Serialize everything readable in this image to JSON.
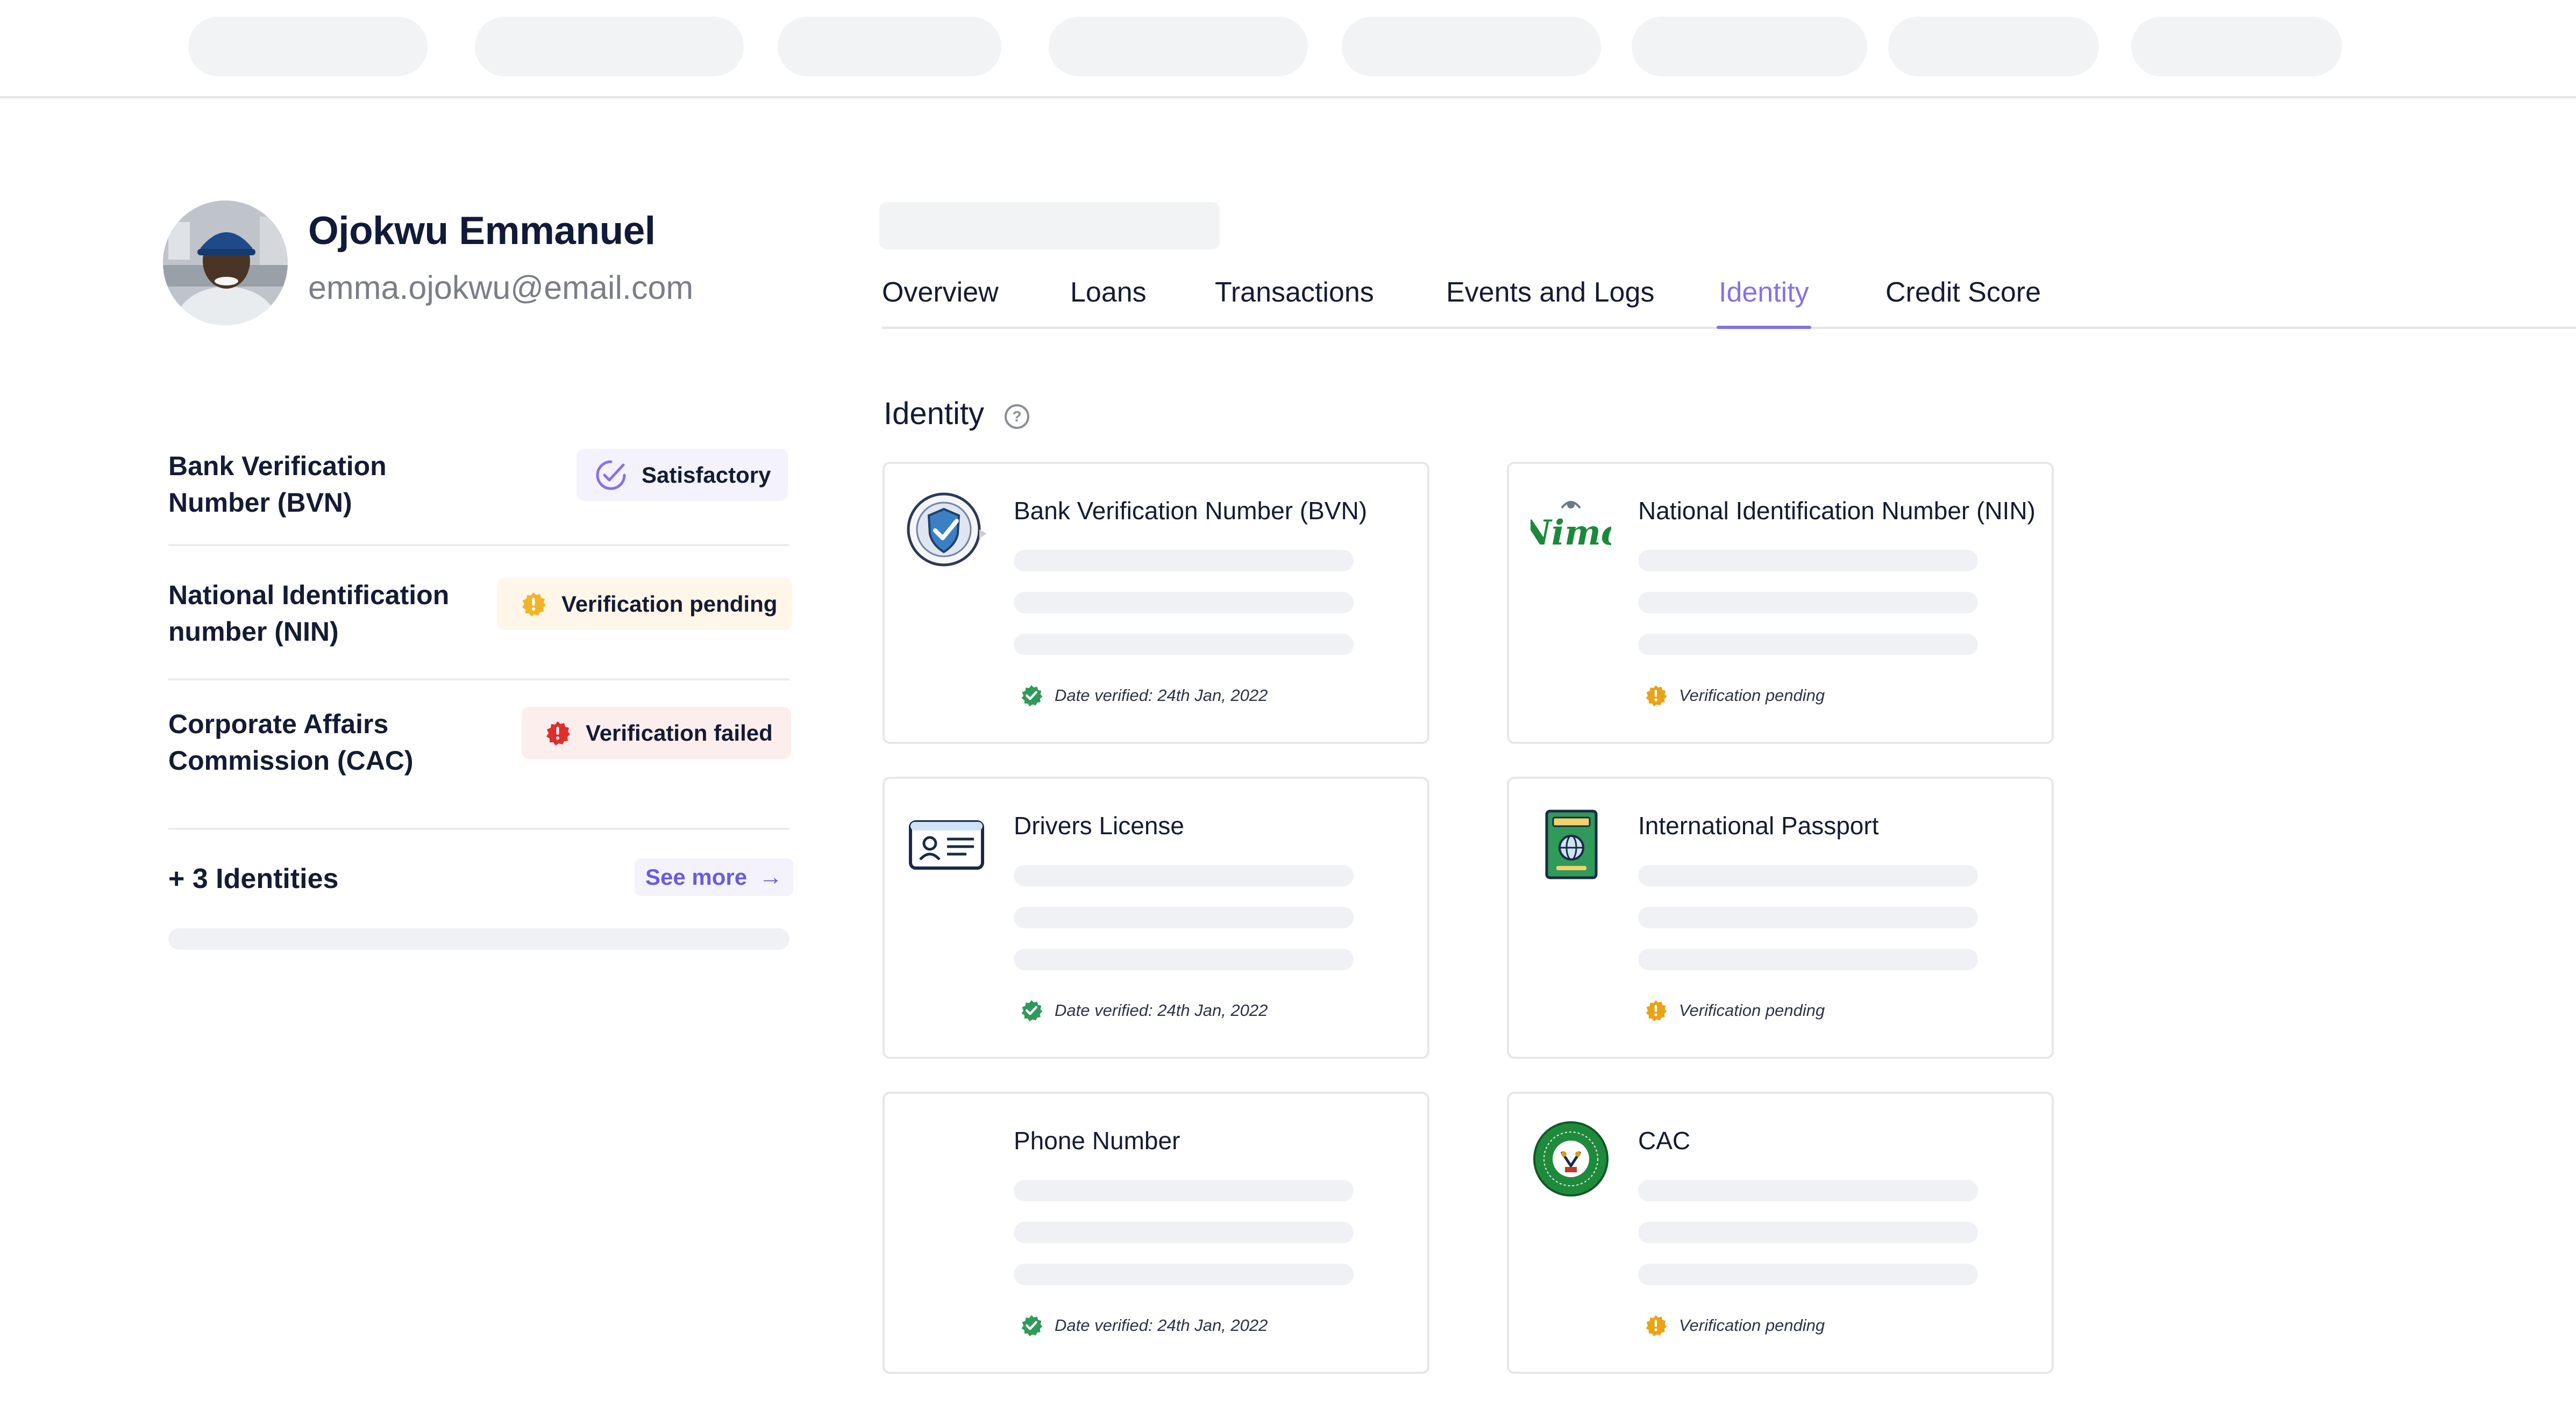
{
  "profile": {
    "name": "Ojokwu Emmanuel",
    "email": "emma.ojokwu@email.com"
  },
  "summary": {
    "items": [
      {
        "label_line1": "Bank Verification",
        "label_line2": "Number (BVN)",
        "badge": "Satisfactory",
        "badge_icon": "check-badge-icon"
      },
      {
        "label_line1": "National Identification",
        "label_line2": "number (NIN)",
        "badge": "Verification pending",
        "badge_icon": "pending-badge-icon"
      },
      {
        "label_line1": "Corporate Affairs",
        "label_line2": "Commission (CAC)",
        "badge": "Verification failed",
        "badge_icon": "failed-badge-icon"
      }
    ],
    "more_label": "+ 3 Identities",
    "see_more": "See more"
  },
  "tabs": [
    {
      "label": "Overview"
    },
    {
      "label": "Loans"
    },
    {
      "label": "Transactions"
    },
    {
      "label": "Events and Logs"
    },
    {
      "label": "Identity",
      "active": true
    },
    {
      "label": "Credit Score"
    }
  ],
  "identity": {
    "title": "Identity",
    "cards": [
      {
        "title": "Bank Verification Number (BVN)",
        "status": "Date verified: 24th Jan, 2022",
        "status_type": "verified",
        "logo": "bvn-logo"
      },
      {
        "title": "National Identification Number (NIN)",
        "status": "Verification pending",
        "status_type": "pending",
        "logo": "nimc-logo",
        "logo_text": "Nimc"
      },
      {
        "title": "Drivers License",
        "status": "Date verified: 24th Jan, 2022",
        "status_type": "verified",
        "logo": "drivers-license-icon"
      },
      {
        "title": "International Passport",
        "status": "Verification pending",
        "status_type": "pending",
        "logo": "passport-icon"
      },
      {
        "title": "Phone Number",
        "status": "Date verified: 24th Jan, 2022",
        "status_type": "verified",
        "logo": ""
      },
      {
        "title": "CAC",
        "status": "Verification pending",
        "status_type": "pending",
        "logo": "cac-seal-logo"
      }
    ]
  },
  "colors": {
    "accent": "#8472e8",
    "verified": "#2f9a5a",
    "pending": "#f0b429",
    "failed": "#e02d2d",
    "satisfactory_bg": "#f3f2fd",
    "pending_bg": "#fff6ea",
    "failed_bg": "#fdeeee"
  }
}
